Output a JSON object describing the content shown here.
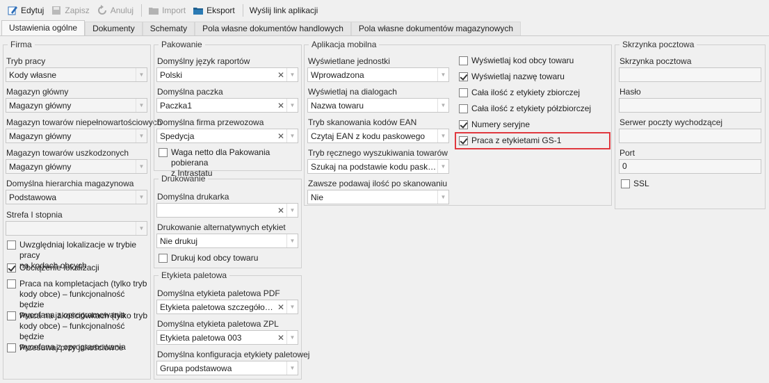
{
  "toolbar": {
    "edit": "Edytuj",
    "save": "Zapisz",
    "cancel": "Anuluj",
    "import": "Import",
    "export": "Eksport",
    "send_link": "Wyślij link aplikacji"
  },
  "tabs": [
    "Ustawienia ogólne",
    "Dokumenty",
    "Schematy",
    "Pola własne dokumentów handlowych",
    "Pola własne dokumentów magazynowych"
  ],
  "firma": {
    "legend": "Firma",
    "tryb_pracy": {
      "label": "Tryb pracy",
      "value": "Kody własne"
    },
    "magazyn_glowny": {
      "label": "Magazyn główny",
      "value": "Magazyn główny"
    },
    "magazyn_niepelno": {
      "label": "Magazyn towarów niepełnowartościowych",
      "value": "Magazyn główny"
    },
    "magazyn_uszk": {
      "label": "Magazyn towarów uszkodzonych",
      "value": "Magazyn główny"
    },
    "hierarchia": {
      "label": "Domyślna hierarchia magazynowa",
      "value": "Podstawowa"
    },
    "strefa": {
      "label": "Strefa I stopnia",
      "value": ""
    },
    "chk1": {
      "line1": "Uwzględniaj lokalizacje w trybie pracy",
      "line2": "na kodach obcych",
      "checked": false
    },
    "chk2": {
      "line1": "Obciążenie lokalizacji",
      "checked": true
    },
    "chk3": {
      "line1": "Praca na kompletacjach (tylko tryb",
      "line2": "kody obce) – funkcjonalność będzie",
      "line3": "wycofana z oprogramowania",
      "checked": false
    },
    "chk4": {
      "line1": "Praca na jakościówkach (tylko tryb",
      "line2": "kody obce) – funkcjonalność będzie",
      "line3": "wycofana z oprogramowania",
      "checked": false
    },
    "chk5": {
      "line1": "Przesuwaj przy jakościówce",
      "checked": false
    }
  },
  "pakowanie": {
    "legend": "Pakowanie",
    "jezyk": {
      "label": "Domyślny język raportów",
      "value": "Polski"
    },
    "paczka": {
      "label": "Domyślna paczka",
      "value": "Paczka1"
    },
    "firma": {
      "label": "Domyślna firma przewozowa",
      "value": "Spedycja"
    },
    "waga": {
      "line1": "Waga netto dla Pakowania pobierana",
      "line2": "z Intrastatu",
      "checked": false
    }
  },
  "drukowanie": {
    "legend": "Drukowanie",
    "drukarka": {
      "label": "Domyślna drukarka",
      "value": ""
    },
    "alt": {
      "label": "Drukowanie alternatywnych etykiet",
      "value": "Nie drukuj"
    },
    "kod_obcy": {
      "line1": "Drukuj kod obcy towaru",
      "checked": false
    }
  },
  "etykieta": {
    "legend": "Etykieta paletowa",
    "pdf": {
      "label": "Domyślna etykieta paletowa PDF",
      "value": "Etykieta paletowa szczegółowa ..."
    },
    "zpl": {
      "label": "Domyślna etykieta paletowa ZPL",
      "value": "Etykieta paletowa 003"
    },
    "konf": {
      "label": "Domyślna konfiguracja etykiety paletowej",
      "value": "Grupa podstawowa"
    }
  },
  "aplikacja": {
    "legend": "Aplikacja mobilna",
    "jednostki": {
      "label": "Wyświetlane jednostki",
      "value": "Wprowadzona"
    },
    "dialogi": {
      "label": "Wyświetlaj na dialogach",
      "value": "Nazwa towaru"
    },
    "ean": {
      "label": "Tryb skanowania kodów EAN",
      "value": "Czytaj EAN z kodu paskowego"
    },
    "reczne": {
      "label": "Tryb ręcznego wyszukiwania towarów",
      "value": "Szukaj na podstawie kodu paskowe..."
    },
    "ilosc": {
      "label": "Zawsze podawaj ilość po skanowaniu",
      "value": "Nie"
    },
    "checks": [
      {
        "label": "Wyświetlaj kod obcy towaru",
        "checked": false
      },
      {
        "label": "Wyświetlaj nazwę towaru",
        "checked": true
      },
      {
        "label": "Cała ilość z etykiety zbiorczej",
        "checked": false
      },
      {
        "label": "Cała ilość z etykiety półzbiorczej",
        "checked": false
      },
      {
        "label": "Numery seryjne",
        "checked": true
      },
      {
        "label": "Praca z etykietami GS-1",
        "checked": true
      }
    ]
  },
  "skrzynka": {
    "legend": "Skrzynka pocztowa",
    "skrzynka": {
      "label": "Skrzynka pocztowa",
      "value": ""
    },
    "haslo": {
      "label": "Hasło",
      "value": ""
    },
    "serwer": {
      "label": "Serwer poczty wychodzącej",
      "value": ""
    },
    "port": {
      "label": "Port",
      "value": "0"
    },
    "ssl": {
      "label": "SSL",
      "checked": false
    }
  },
  "colors": {
    "highlight": "#e0383e",
    "accent": "#1f6fb5"
  }
}
